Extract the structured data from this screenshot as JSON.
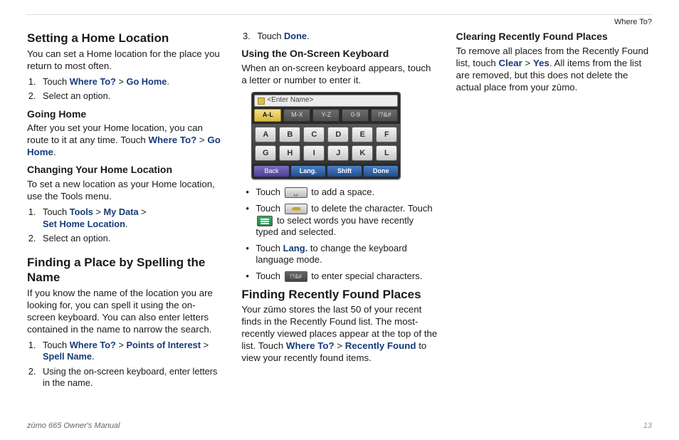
{
  "header": {
    "section": "Where To?"
  },
  "footer": {
    "manual": "zūmo 665 Owner's Manual",
    "page": "13"
  },
  "links": {
    "where_to": "Where To?",
    "go_home": "Go Home",
    "tools": "Tools",
    "my_data": "My Data",
    "set_home": "Set Home Location",
    "poi": "Points of Interest",
    "spell_name": "Spell Name",
    "done": "Done",
    "lang": "Lang.",
    "recently_found": "Recently Found",
    "clear": "Clear",
    "yes": "Yes"
  },
  "col1": {
    "h_set_home": "Setting a Home Location",
    "p_set_home": "You can set a Home location for the place you return to most often.",
    "ol1_1_pre": "Touch ",
    "ol1_2": "Select an option.",
    "h_going": "Going Home",
    "p_going_a": "After you set your Home location, you can route to it at any time. Touch ",
    "h_changing": "Changing Your Home Location",
    "p_changing": "To set a new location as your Home location, use the Tools menu.",
    "ol2_1_pre": "Touch ",
    "ol2_2": "Select an option.",
    "h_spell": "Finding a Place by Spelling the Name",
    "p_spell": "If you know the name of the location you are looking for, you can spell it using the on-screen keyboard. You can also enter letters contained in the name to narrow the search."
  },
  "col2": {
    "ol3_1_pre": "Touch ",
    "ol3_2": "Using the on-screen keyboard, enter letters in the name.",
    "ol3_3_pre": "Touch ",
    "h_osk": "Using the On-Screen Keyboard",
    "p_osk": "When an on-screen keyboard appears, touch a letter or number to enter it.",
    "kb": {
      "placeholder": "<Enter Name>",
      "tabs": [
        "A-L",
        "M-X",
        "Y-Z",
        "0-9",
        "!?&#"
      ],
      "keys": [
        "A",
        "B",
        "C",
        "D",
        "E",
        "F",
        "G",
        "H",
        "I",
        "J",
        "K",
        "L"
      ],
      "bottom": [
        "Back",
        "Lang.",
        "Shift",
        "Done"
      ]
    },
    "b_space_a": "Touch ",
    "b_space_b": " to add a space.",
    "b_del_a": "Touch ",
    "b_del_b": " to delete the character. Touch ",
    "b_del_c": " to select words you have recently typed and selected.",
    "b_lang_a": "Touch ",
    "b_lang_b": " to change the keyboard language mode.",
    "b_sym_a": "Touch ",
    "b_sym_b": " to enter special characters.",
    "sym_label": "!?&#"
  },
  "col3": {
    "h_recent": "Finding Recently Found Places",
    "p_recent_a": "Your zūmo stores the last 50 of your recent finds in the Recently Found list. The most-recently viewed places appear at the top of the list. Touch ",
    "p_recent_b": " to view your recently found items.",
    "h_clear": "Clearing Recently Found Places",
    "p_clear_a": "To remove all places from the Recently Found list, touch ",
    "p_clear_b": ". All items from the list are removed, but this does not delete the actual place from your zūmo."
  }
}
